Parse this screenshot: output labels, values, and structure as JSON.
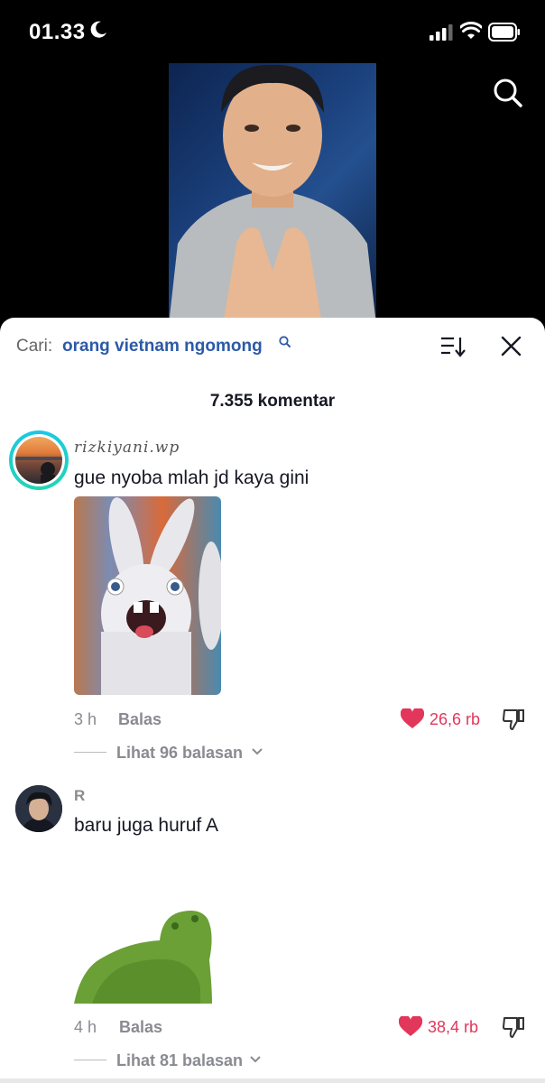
{
  "status_bar": {
    "time": "01.33"
  },
  "search": {
    "label": "Cari:",
    "query": "orang vietnam ngomong"
  },
  "comments_header": {
    "count_text": "7.355 komentar"
  },
  "comments": [
    {
      "username": "rizkiyani.wp",
      "text": "gue nyoba mlah jd kaya gini",
      "time": "3 h",
      "reply_label": "Balas",
      "likes": "26,6 rb",
      "view_replies": "Lihat 96 balasan"
    },
    {
      "username": "R",
      "text": "baru juga huruf A",
      "time": "4 h",
      "reply_label": "Balas",
      "likes": "38,4 rb",
      "view_replies": "Lihat 81 balasan"
    }
  ],
  "colors": {
    "like": "#e2365a",
    "query": "#2b5aa8",
    "ring": "#18c8e8"
  }
}
